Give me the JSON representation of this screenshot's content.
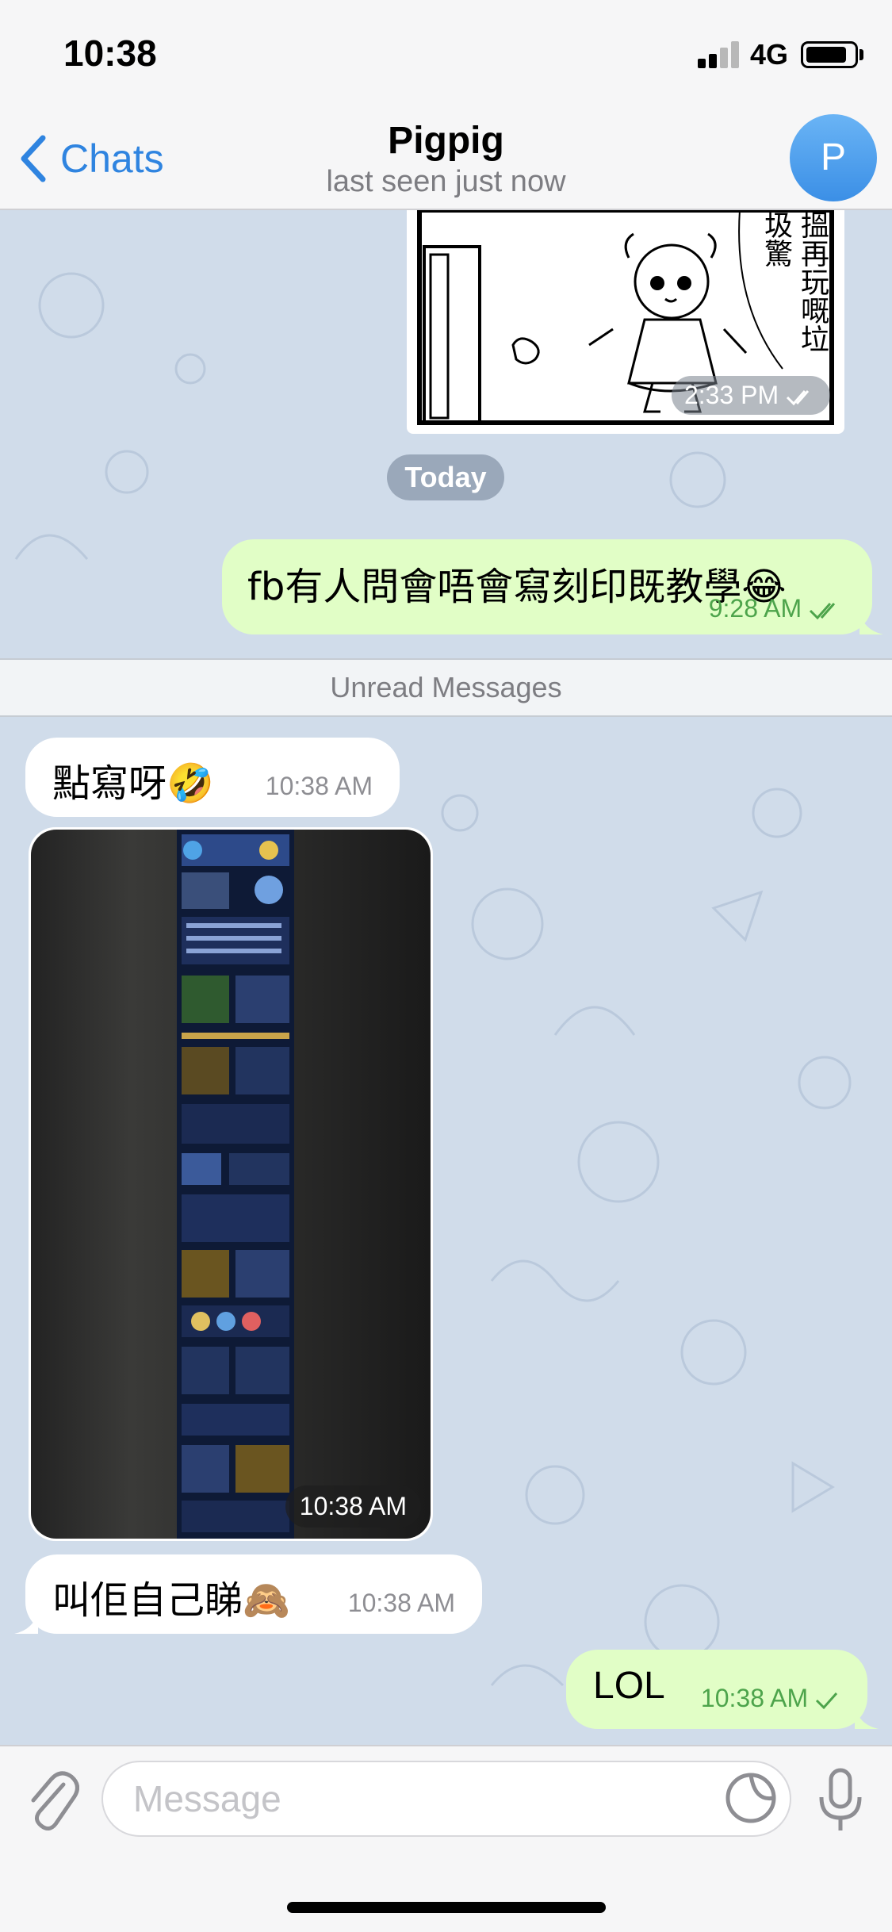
{
  "status_bar": {
    "time": "10:38",
    "network": "4G"
  },
  "nav": {
    "back_label": "Chats",
    "title": "Pigpig",
    "subtitle": "last seen just now",
    "avatar_initial": "P"
  },
  "chat": {
    "comic_text": "搵再玩嘅垃圾驚",
    "comic_time": "2:33 PM",
    "date_separator": "Today",
    "unread_label": "Unread Messages",
    "messages": [
      {
        "direction": "out",
        "text": "fb有人問會唔會寫刻印既教學😂",
        "time": "9:28 AM",
        "status": "read"
      },
      {
        "direction": "in",
        "text": "點寫呀🤣",
        "time": "10:38 AM"
      },
      {
        "direction": "in",
        "type": "photo",
        "time": "10:38 AM"
      },
      {
        "direction": "in",
        "text": "叫佢自己睇🙈",
        "time": "10:38 AM"
      },
      {
        "direction": "out",
        "text": "LOL",
        "time": "10:38 AM",
        "status": "sent"
      }
    ]
  },
  "input": {
    "placeholder": "Message"
  },
  "icons": {
    "back": "chevron-left-icon",
    "attach": "paperclip-icon",
    "sticker": "sticker-icon",
    "mic": "microphone-icon",
    "read_receipt": "double-check-icon",
    "sent_receipt": "check-icon"
  },
  "colors": {
    "accent": "#2f84e0",
    "outgoing_bubble": "#e1fec6",
    "incoming_bubble": "#ffffff",
    "chat_background": "#d0dcea",
    "outgoing_time": "#4da44b"
  }
}
